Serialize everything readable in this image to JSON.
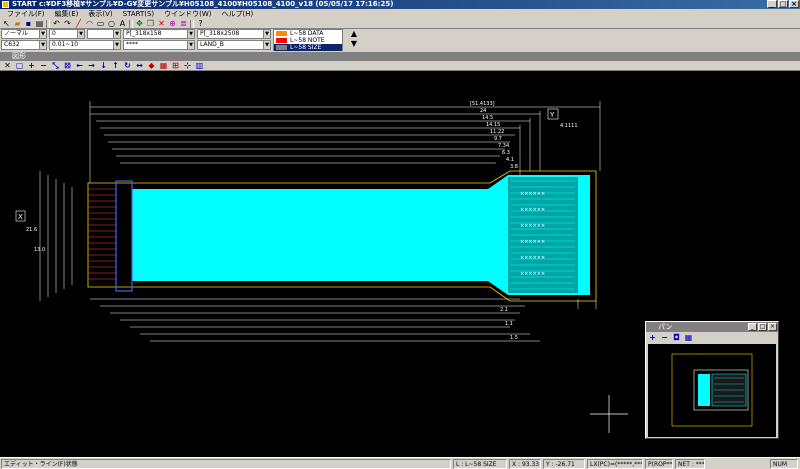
{
  "window": {
    "title": "START c:¥DF3移植¥サンプル¥D-G¥変更サンプル¥H05108_4100¥H05108_4100_v18 (05/05/17 17:16:25)",
    "buttons": [
      "_",
      "□",
      "×"
    ]
  },
  "menu": [
    "ファイル(F)",
    "編集(E)",
    "表示(V)",
    "START(S)",
    "ウインドウ(W)",
    "ヘルプ(H)"
  ],
  "toolbar_icons": [
    "pointer-icon",
    "open-icon",
    "save-icon",
    "print-icon",
    "undo-icon",
    "redo-icon",
    "line-icon",
    "arc-icon",
    "rect-icon",
    "circle-icon",
    "text-icon",
    "move-icon",
    "copy-icon",
    "delete-icon",
    "zoom-icon",
    "layer-icon",
    "help-icon"
  ],
  "properties": {
    "mode": "ノーマル",
    "num1": "0",
    "num2": "",
    "pad_a": "P[_318x158",
    "pad_b": "P[_318x2508",
    "layer_code": "C632",
    "layer_range": "0.01~10",
    "pattern": "****",
    "land": "LAND_B"
  },
  "layers": [
    {
      "label": "L~58 DATA",
      "color": "#ff8c00",
      "selected": false
    },
    {
      "label": "L~58 NOTE",
      "color": "#ff0000",
      "selected": false
    },
    {
      "label": "L~58 SIZE",
      "color": "#808080",
      "selected": true
    }
  ],
  "child_window": {
    "title": "図形"
  },
  "drawing": {
    "background": "#000000",
    "board_color": "#00ffff",
    "dim_color": "#ffffff",
    "outline_color": "#ffd700",
    "side_labels": [
      "X",
      "Y"
    ],
    "dimension_texts": [
      "[51.4133]",
      "24",
      "14.5",
      "14.15",
      "11.22",
      "9.7",
      "7.34",
      "6.3",
      "4.1",
      "3.8",
      "2.1",
      "1.1",
      "1.5",
      "4.1111",
      "21.6",
      "13.0"
    ]
  },
  "mini_window": {
    "title": "パン",
    "tools": [
      "+",
      "−",
      "◘",
      "▦"
    ]
  },
  "status": {
    "message": "エディット・ライン(F)状態",
    "layer": "L : L~58 SIZE",
    "x": "X : 93.33",
    "y": "Y : -26.71",
    "lxy": "LX(PC)=(*****,*****)",
    "ps": "P(ROP**)",
    "net": "NET : ****",
    "num": "NUM"
  }
}
